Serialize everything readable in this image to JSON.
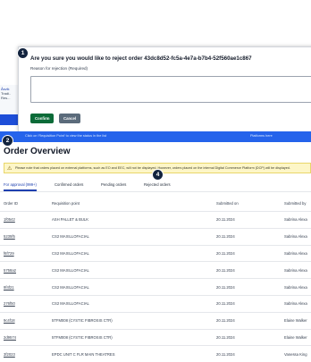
{
  "background_panel": {
    "lines": [
      "Åsvik",
      "Tradi..",
      "Res..."
    ]
  },
  "dialog": {
    "badge": "1",
    "title": "Are you sure you would like to reject order 43dc8d52-fc5a-4e7a-b7b4-52f560ae1c867",
    "reason_label": "Reason for rejection (Required)",
    "reason_value": "",
    "confirm_label": "Confirm",
    "cancel_label": "Cancel"
  },
  "info_bar": {
    "badge": "2",
    "text": "Click on ‘Requisition Point’ to view the status in the list",
    "right_text": "Platforms here"
  },
  "page": {
    "title": "Order Overview"
  },
  "notice": {
    "icon": "warning-icon",
    "text": "Please note that orders placed on external platforms, such as EO and EEC, will not be displayed. However, orders placed on the internal Digital Commerce Platform (DCP) will be displayed."
  },
  "tabs": [
    {
      "label": "For approval (999+)",
      "active": true
    },
    {
      "label": "Confirmed orders",
      "active": false
    },
    {
      "label": "Pending orders",
      "active": false
    },
    {
      "label": "Rejected orders",
      "active": false
    }
  ],
  "tab_badge": "4",
  "table": {
    "headers": [
      "Order ID",
      "Requisition point",
      "Submitted on",
      "Submitted by"
    ],
    "rows": [
      [
        "1f0542",
        "ASH PALLET & BULK",
        "20.11.2024",
        "Sabrina Alexa"
      ],
      [
        "5235f5",
        "CS2 MAXILLOFACIAL",
        "20.11.2024",
        "Sabrina Alexa"
      ],
      [
        "f6f729",
        "CS2 MAXILLOFACIAL",
        "20.11.2024",
        "Sabrina Alexa"
      ],
      [
        "5758a2",
        "CS2 MAXILLOFACIAL",
        "20.11.2024",
        "Sabrina Alexa"
      ],
      [
        "9f4f21",
        "CS2 MAXILLOFACIAL",
        "20.11.2024",
        "Sabrina Alexa"
      ],
      [
        "276f50",
        "CS2 MAXILLOFACIAL",
        "20.11.2024",
        "Sabrina Alexa"
      ],
      [
        "9c4f18",
        "5TFM008 (CYSTIC FIBROSIS CTR)",
        "20.11.2024",
        "Elaine Walker"
      ],
      [
        "2d9574",
        "5TFM008 (CYSTIC FIBROSIS CTR)",
        "20.11.2024",
        "Elaine Walker"
      ],
      [
        "3f2023",
        "EPDC UNIT C FLR MAIN THEATRES",
        "20.11.2024",
        "Vanessa King"
      ]
    ]
  }
}
